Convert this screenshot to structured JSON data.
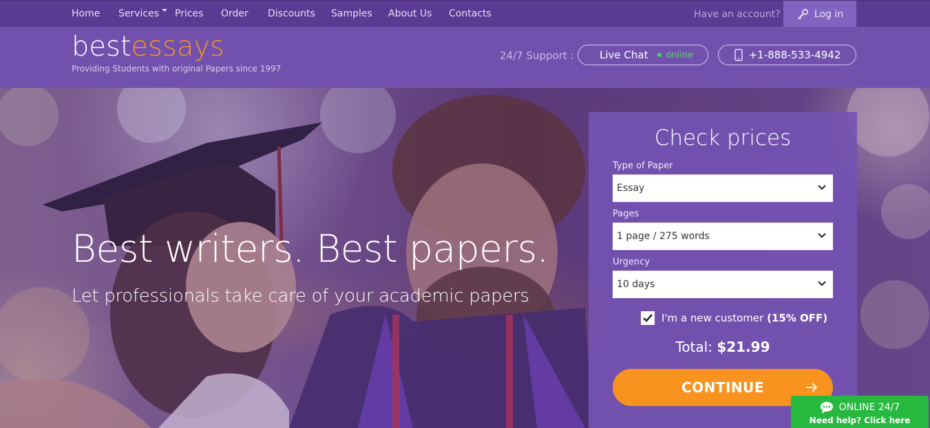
{
  "nav": {
    "items": [
      {
        "label": "Home"
      },
      {
        "label": "Services"
      },
      {
        "label": "Prices"
      },
      {
        "label": "Order"
      },
      {
        "label": "Discounts"
      },
      {
        "label": "Samples"
      },
      {
        "label": "About Us"
      },
      {
        "label": "Contacts"
      }
    ],
    "have_account": "Have an account?",
    "login": "Log in"
  },
  "header": {
    "logo_part1": "best",
    "logo_part2": "essays",
    "tagline": "Providing Students with original Papers since 1997",
    "support_label": "24/7 Support :",
    "live_chat": "Live Chat",
    "live_status": "online",
    "phone": "+1-888-533-4942"
  },
  "hero": {
    "headline": "Best writers.  Best papers.",
    "subheadline": "Let professionals take care of your academic papers"
  },
  "price_form": {
    "title": "Check prices",
    "type_label": "Type of Paper",
    "type_value": "Essay",
    "pages_label": "Pages",
    "pages_value": "1 page / 275 words",
    "urgency_label": "Urgency",
    "urgency_value": "10 days",
    "new_customer_label": "I'm a new customer",
    "new_customer_discount": "(15% OFF)",
    "new_customer_checked": true,
    "total_label": "Total:",
    "total_value": "$21.99",
    "continue": "CONTINUE"
  },
  "chat_widget": {
    "title": "ONLINE 24/7",
    "subtitle": "Need help? Click here"
  },
  "colors": {
    "nav_bg": "#5b3a93",
    "header_bg": "#7151ad",
    "accent_orange": "#f7931e",
    "online_green": "#57d96a",
    "chat_green": "#27b83f"
  }
}
